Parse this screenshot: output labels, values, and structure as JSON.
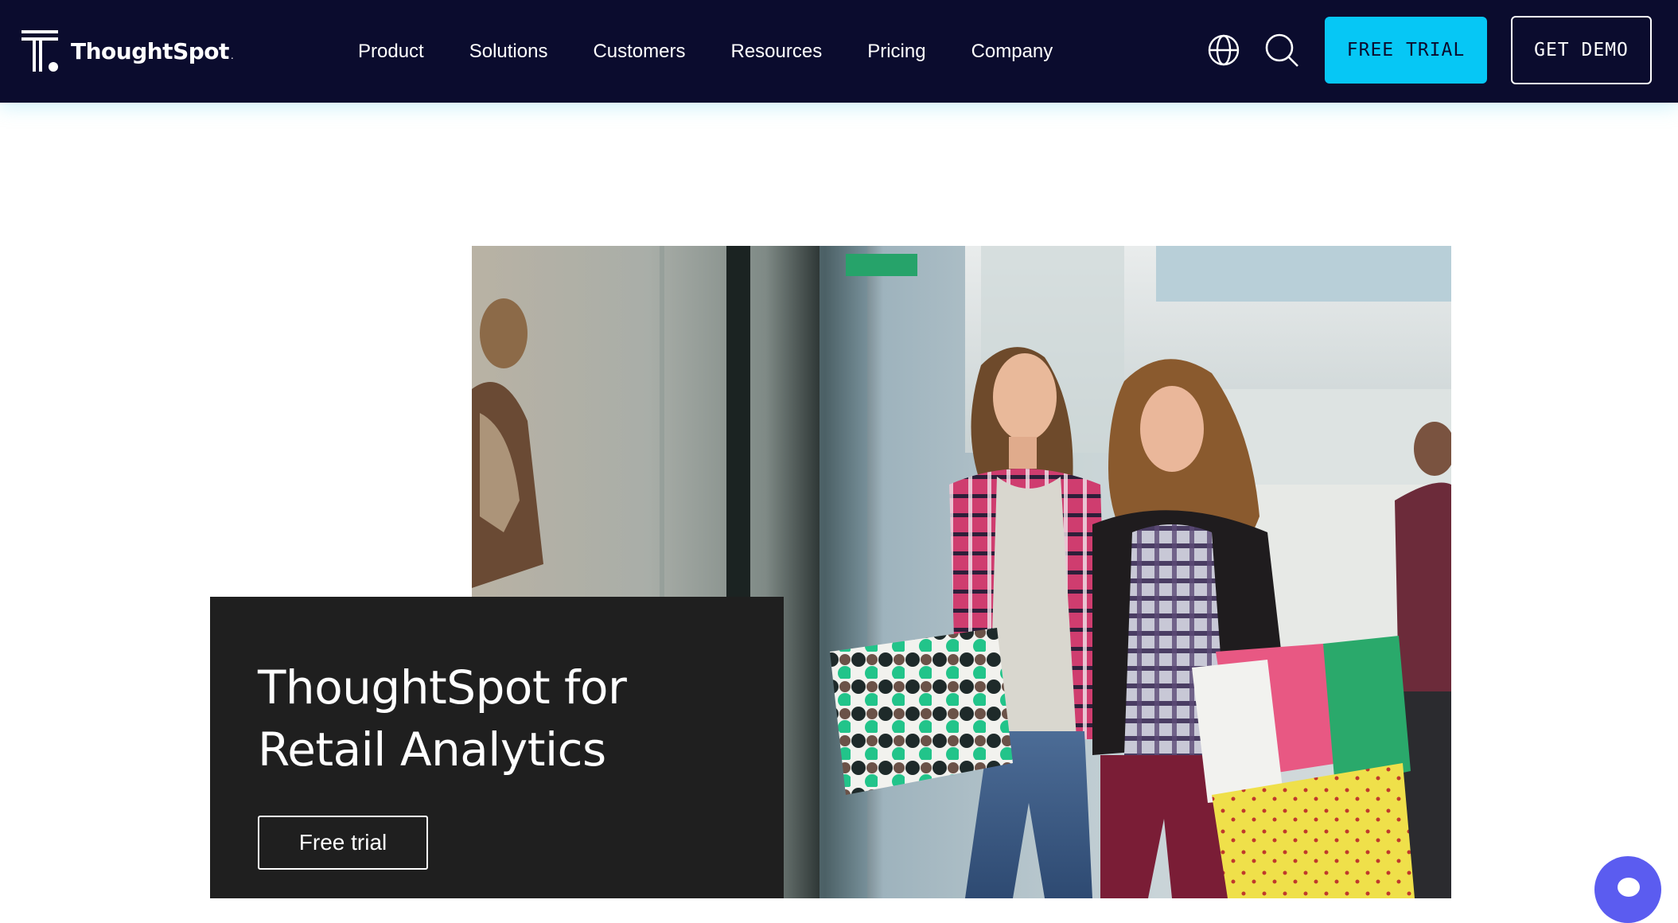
{
  "brand": {
    "name": "ThoughtSpot",
    "dot": ".",
    "colors": {
      "nav_bg": "#0b0c2e",
      "accent": "#06c7f5",
      "card_bg": "#1f1f1f",
      "chat": "#5b5cf0"
    }
  },
  "nav": {
    "items": [
      {
        "label": "Product"
      },
      {
        "label": "Solutions"
      },
      {
        "label": "Customers"
      },
      {
        "label": "Resources"
      },
      {
        "label": "Pricing"
      },
      {
        "label": "Company"
      }
    ],
    "icons": [
      "globe-icon",
      "search-icon"
    ],
    "free_trial_label": "FREE TRIAL",
    "get_demo_label": "GET DEMO"
  },
  "hero": {
    "title": "ThoughtSpot for Retail Analytics",
    "cta_label": "Free trial",
    "image": "photo of two women shopping in a mall with shopping bags"
  },
  "chat": {
    "icon": "chat-icon"
  }
}
